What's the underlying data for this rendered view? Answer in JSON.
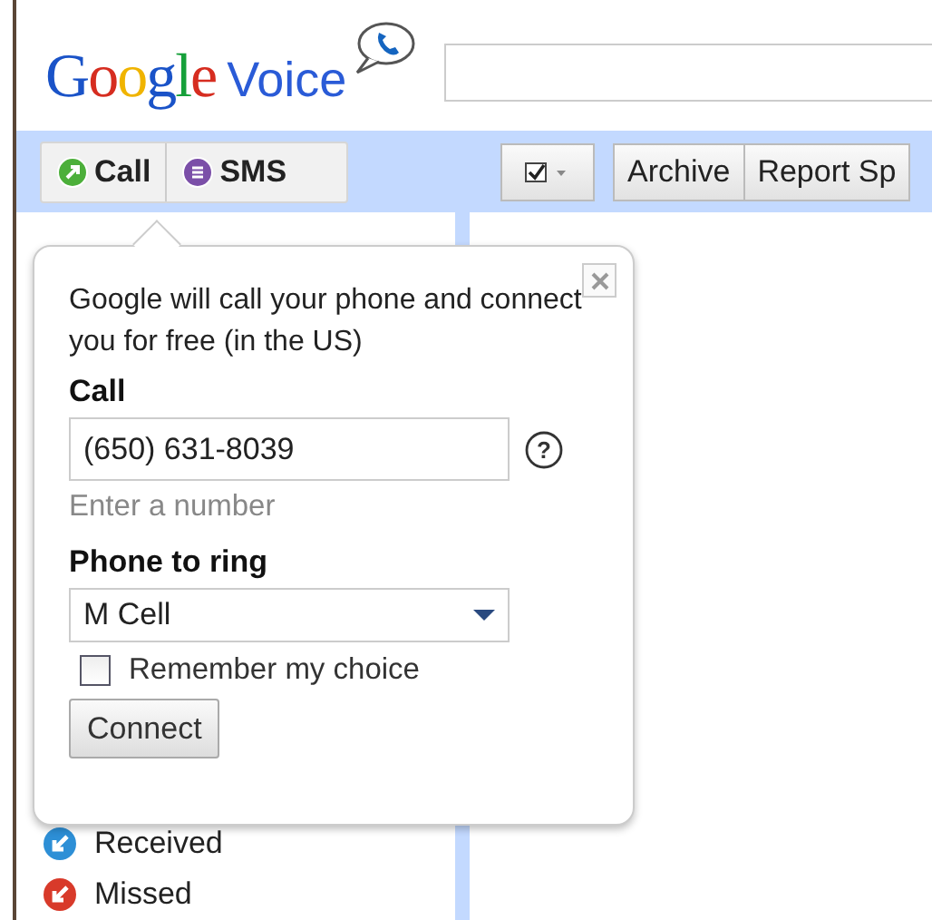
{
  "logo": {
    "brand": "Google",
    "product": "Voice"
  },
  "compose_buttons": [
    {
      "label": "Call",
      "kind": "call"
    },
    {
      "label": "SMS",
      "kind": "sms"
    }
  ],
  "toolbar": {
    "buttons": [
      "Archive",
      "Report Sp"
    ]
  },
  "call_popup": {
    "message": "Google will call your phone and connect you for free (in the US)",
    "call_label": "Call",
    "number": "(650) 631-8039",
    "help": "?",
    "hint": "Enter a number",
    "ring_label": "Phone to ring",
    "phone": "M Cell",
    "remember": {
      "label": "Remember my choice",
      "checked": false
    },
    "connect": "Connect"
  },
  "sidebar": {
    "items": [
      {
        "label": "Received",
        "kind": "received"
      },
      {
        "label": "Missed",
        "kind": "missed"
      }
    ]
  }
}
